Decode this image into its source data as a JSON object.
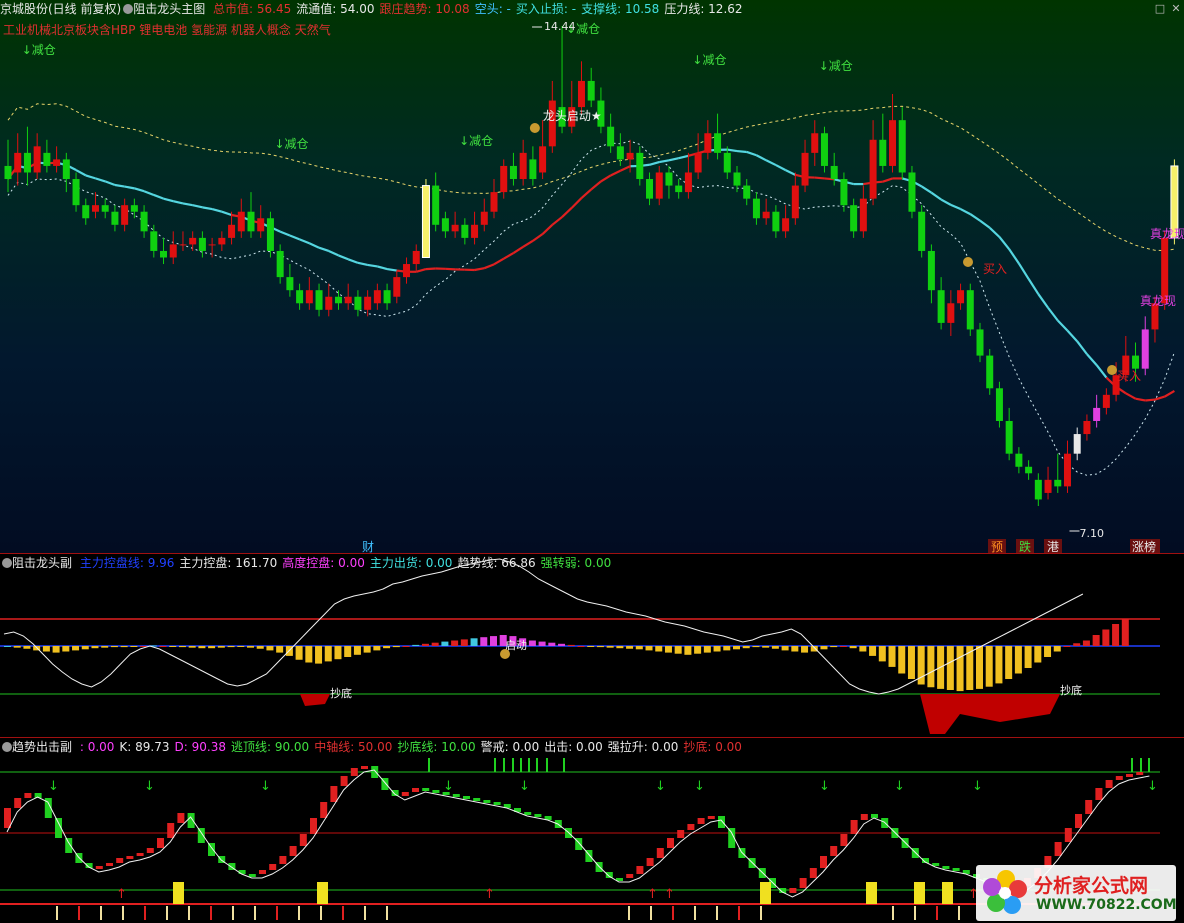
{
  "main": {
    "stock_name": "京城股份(日线 前复权)",
    "indicator": "阻击龙头主图",
    "fields": [
      {
        "label": "总市值:",
        "value": "56.45",
        "color": "#e03030"
      },
      {
        "label": "流通值:",
        "value": "54.00",
        "color": "#e8e8e8"
      },
      {
        "label": "跟庄趋势:",
        "value": "10.08",
        "color": "#e03030"
      },
      {
        "label": "空头:",
        "value": "-",
        "color": "#40c0ff"
      },
      {
        "label": "买入止损:",
        "value": "-",
        "color": "#40e0e0"
      },
      {
        "label": "支撑线:",
        "value": "10.58",
        "color": "#40e0e0"
      },
      {
        "label": "压力线:",
        "value": "12.62",
        "color": "#e8e8e8"
      }
    ],
    "concepts": "工业机械北京板块含HBP 锂电电池 氢能源 机器人概念 天然气",
    "high_label": "14.44",
    "low_label": "7.10",
    "labels": {
      "reduce": "减仓",
      "dragon_start": "龙头启动★",
      "true_dragon": "真龙现",
      "buy": "买入"
    },
    "bottom_tags": {
      "cai": "财",
      "yu": "预",
      "die": "跌",
      "gang": "港",
      "zhangbang": "涨榜"
    }
  },
  "sub": {
    "indicator": "阻击龙头副",
    "fields": [
      {
        "label": "主力控盘线:",
        "value": "9.96",
        "color": "#2040ff"
      },
      {
        "label": "主力控盘:",
        "value": "161.70",
        "color": "#e8e8e8"
      },
      {
        "label": "高度控盘:",
        "value": "0.00",
        "color": "#ff40ff"
      },
      {
        "label": "主力出货:",
        "value": "0.00",
        "color": "#40e0e0"
      },
      {
        "label": "趋势线:",
        "value": "66.86",
        "color": "#e8e8e8"
      },
      {
        "label": "强转弱:",
        "value": "0.00",
        "color": "#40e040"
      }
    ],
    "labels": {
      "bottom": "抄底",
      "start": "启动"
    }
  },
  "kdj": {
    "indicator": "趋势出击副",
    "fields": [
      {
        "label": ":",
        "value": "0.00",
        "color": "#ff40ff"
      },
      {
        "label": "K:",
        "value": "89.73",
        "color": "#e8e8e8"
      },
      {
        "label": "D:",
        "value": "90.38",
        "color": "#ff40ff"
      },
      {
        "label": "逃顶线:",
        "value": "90.00",
        "color": "#40e040"
      },
      {
        "label": "中轴线:",
        "value": "50.00",
        "color": "#e03030"
      },
      {
        "label": "抄底线:",
        "value": "10.00",
        "color": "#40e040"
      },
      {
        "label": "警戒:",
        "value": "0.00",
        "color": "#e8e8e8"
      },
      {
        "label": "出击:",
        "value": "0.00",
        "color": "#e8e8e8"
      },
      {
        "label": "强拉升:",
        "value": "0.00",
        "color": "#e8e8e8"
      },
      {
        "label": "抄底:",
        "value": "0.00",
        "color": "#e03030"
      }
    ]
  },
  "logo": {
    "name": "分析家公式网",
    "url": "WWW.70822.COM"
  },
  "chart_data": {
    "type": "candlestick",
    "y_range": [
      7.1,
      14.44
    ],
    "candles": [
      {
        "o": 12.3,
        "c": 12.1,
        "h": 12.7,
        "l": 11.9
      },
      {
        "o": 12.2,
        "c": 12.5,
        "h": 12.8,
        "l": 12.0
      },
      {
        "o": 12.5,
        "c": 12.2,
        "h": 12.9,
        "l": 12.0
      },
      {
        "o": 12.2,
        "c": 12.6,
        "h": 12.8,
        "l": 12.1
      },
      {
        "o": 12.5,
        "c": 12.3,
        "h": 12.7,
        "l": 12.2
      },
      {
        "o": 12.3,
        "c": 12.4,
        "h": 12.6,
        "l": 12.2
      },
      {
        "o": 12.4,
        "c": 12.1,
        "h": 12.5,
        "l": 11.9
      },
      {
        "o": 12.1,
        "c": 11.7,
        "h": 12.2,
        "l": 11.6
      },
      {
        "o": 11.7,
        "c": 11.5,
        "h": 11.8,
        "l": 11.4
      },
      {
        "o": 11.6,
        "c": 11.7,
        "h": 11.9,
        "l": 11.5
      },
      {
        "o": 11.7,
        "c": 11.6,
        "h": 11.8,
        "l": 11.5
      },
      {
        "o": 11.6,
        "c": 11.4,
        "h": 11.7,
        "l": 11.3
      },
      {
        "o": 11.4,
        "c": 11.7,
        "h": 11.8,
        "l": 11.3
      },
      {
        "o": 11.7,
        "c": 11.6,
        "h": 11.8,
        "l": 11.5
      },
      {
        "o": 11.6,
        "c": 11.3,
        "h": 11.7,
        "l": 11.2
      },
      {
        "o": 11.3,
        "c": 11.0,
        "h": 11.4,
        "l": 10.9
      },
      {
        "o": 11.0,
        "c": 10.9,
        "h": 11.2,
        "l": 10.8
      },
      {
        "o": 10.9,
        "c": 11.1,
        "h": 11.3,
        "l": 10.8
      },
      {
        "o": 11.1,
        "c": 11.1,
        "h": 11.3,
        "l": 11.0
      },
      {
        "o": 11.1,
        "c": 11.2,
        "h": 11.3,
        "l": 11.0
      },
      {
        "o": 11.2,
        "c": 11.0,
        "h": 11.3,
        "l": 10.9
      },
      {
        "o": 11.1,
        "c": 11.1,
        "h": 11.2,
        "l": 10.9
      },
      {
        "o": 11.1,
        "c": 11.2,
        "h": 11.3,
        "l": 11.0
      },
      {
        "o": 11.2,
        "c": 11.4,
        "h": 11.6,
        "l": 11.1
      },
      {
        "o": 11.3,
        "c": 11.6,
        "h": 11.8,
        "l": 11.2
      },
      {
        "o": 11.6,
        "c": 11.3,
        "h": 11.9,
        "l": 11.2
      },
      {
        "o": 11.3,
        "c": 11.5,
        "h": 11.7,
        "l": 11.2
      },
      {
        "o": 11.5,
        "c": 11.0,
        "h": 11.6,
        "l": 10.9
      },
      {
        "o": 11.0,
        "c": 10.6,
        "h": 11.1,
        "l": 10.5
      },
      {
        "o": 10.6,
        "c": 10.4,
        "h": 10.8,
        "l": 10.3
      },
      {
        "o": 10.4,
        "c": 10.2,
        "h": 10.5,
        "l": 10.1
      },
      {
        "o": 10.2,
        "c": 10.4,
        "h": 10.6,
        "l": 10.1
      },
      {
        "o": 10.4,
        "c": 10.1,
        "h": 10.5,
        "l": 10.0
      },
      {
        "o": 10.1,
        "c": 10.3,
        "h": 10.5,
        "l": 10.0
      },
      {
        "o": 10.3,
        "c": 10.2,
        "h": 10.4,
        "l": 10.1
      },
      {
        "o": 10.2,
        "c": 10.3,
        "h": 10.5,
        "l": 10.1
      },
      {
        "o": 10.3,
        "c": 10.1,
        "h": 10.4,
        "l": 10.0
      },
      {
        "o": 10.1,
        "c": 10.3,
        "h": 10.4,
        "l": 10.0
      },
      {
        "o": 10.2,
        "c": 10.4,
        "h": 10.5,
        "l": 10.1
      },
      {
        "o": 10.4,
        "c": 10.2,
        "h": 10.5,
        "l": 10.1
      },
      {
        "o": 10.3,
        "c": 10.6,
        "h": 10.7,
        "l": 10.2
      },
      {
        "o": 10.6,
        "c": 10.8,
        "h": 10.9,
        "l": 10.5
      },
      {
        "o": 10.8,
        "c": 11.0,
        "h": 11.1,
        "l": 10.7
      },
      {
        "o": 10.9,
        "c": 12.0,
        "h": 12.1,
        "l": 10.9
      },
      {
        "o": 12.0,
        "c": 11.4,
        "h": 12.2,
        "l": 11.3
      },
      {
        "o": 11.5,
        "c": 11.3,
        "h": 11.6,
        "l": 11.2
      },
      {
        "o": 11.3,
        "c": 11.4,
        "h": 11.6,
        "l": 11.2
      },
      {
        "o": 11.4,
        "c": 11.2,
        "h": 11.5,
        "l": 11.1
      },
      {
        "o": 11.2,
        "c": 11.4,
        "h": 11.6,
        "l": 11.1
      },
      {
        "o": 11.4,
        "c": 11.6,
        "h": 11.8,
        "l": 11.3
      },
      {
        "o": 11.6,
        "c": 11.9,
        "h": 12.1,
        "l": 11.5
      },
      {
        "o": 11.9,
        "c": 12.3,
        "h": 12.4,
        "l": 11.8
      },
      {
        "o": 12.3,
        "c": 12.1,
        "h": 12.5,
        "l": 12.0
      },
      {
        "o": 12.1,
        "c": 12.5,
        "h": 12.7,
        "l": 12.0
      },
      {
        "o": 12.4,
        "c": 12.1,
        "h": 12.6,
        "l": 12.0
      },
      {
        "o": 12.2,
        "c": 12.6,
        "h": 13.0,
        "l": 12.1
      },
      {
        "o": 12.6,
        "c": 13.3,
        "h": 13.6,
        "l": 12.5
      },
      {
        "o": 13.2,
        "c": 12.9,
        "h": 14.44,
        "l": 12.8
      },
      {
        "o": 12.9,
        "c": 13.2,
        "h": 13.6,
        "l": 12.8
      },
      {
        "o": 13.2,
        "c": 13.6,
        "h": 13.9,
        "l": 13.1
      },
      {
        "o": 13.6,
        "c": 13.3,
        "h": 13.8,
        "l": 13.2
      },
      {
        "o": 13.3,
        "c": 12.9,
        "h": 13.5,
        "l": 12.8
      },
      {
        "o": 12.9,
        "c": 12.6,
        "h": 13.1,
        "l": 12.5
      },
      {
        "o": 12.6,
        "c": 12.4,
        "h": 12.8,
        "l": 12.3
      },
      {
        "o": 12.4,
        "c": 12.5,
        "h": 12.7,
        "l": 12.2
      },
      {
        "o": 12.5,
        "c": 12.1,
        "h": 12.6,
        "l": 12.0
      },
      {
        "o": 12.1,
        "c": 11.8,
        "h": 12.2,
        "l": 11.7
      },
      {
        "o": 11.8,
        "c": 12.2,
        "h": 12.3,
        "l": 11.7
      },
      {
        "o": 12.2,
        "c": 12.0,
        "h": 12.3,
        "l": 11.8
      },
      {
        "o": 12.0,
        "c": 11.9,
        "h": 12.1,
        "l": 11.8
      },
      {
        "o": 11.9,
        "c": 12.2,
        "h": 12.5,
        "l": 11.8
      },
      {
        "o": 12.2,
        "c": 12.5,
        "h": 12.8,
        "l": 12.1
      },
      {
        "o": 12.5,
        "c": 12.8,
        "h": 13.0,
        "l": 12.4
      },
      {
        "o": 12.8,
        "c": 12.5,
        "h": 13.1,
        "l": 12.4
      },
      {
        "o": 12.5,
        "c": 12.2,
        "h": 12.6,
        "l": 12.1
      },
      {
        "o": 12.2,
        "c": 12.0,
        "h": 12.3,
        "l": 11.9
      },
      {
        "o": 12.0,
        "c": 11.8,
        "h": 12.1,
        "l": 11.7
      },
      {
        "o": 11.8,
        "c": 11.5,
        "h": 11.9,
        "l": 11.4
      },
      {
        "o": 11.5,
        "c": 11.6,
        "h": 11.8,
        "l": 11.4
      },
      {
        "o": 11.6,
        "c": 11.3,
        "h": 11.7,
        "l": 11.2
      },
      {
        "o": 11.3,
        "c": 11.5,
        "h": 11.7,
        "l": 11.2
      },
      {
        "o": 11.5,
        "c": 12.0,
        "h": 12.2,
        "l": 11.4
      },
      {
        "o": 12.0,
        "c": 12.5,
        "h": 12.7,
        "l": 11.9
      },
      {
        "o": 12.5,
        "c": 12.8,
        "h": 13.0,
        "l": 12.3
      },
      {
        "o": 12.8,
        "c": 12.3,
        "h": 12.9,
        "l": 12.2
      },
      {
        "o": 12.3,
        "c": 12.1,
        "h": 12.5,
        "l": 12.0
      },
      {
        "o": 12.1,
        "c": 11.7,
        "h": 12.2,
        "l": 11.6
      },
      {
        "o": 11.7,
        "c": 11.3,
        "h": 11.8,
        "l": 11.2
      },
      {
        "o": 11.3,
        "c": 11.8,
        "h": 12.0,
        "l": 11.2
      },
      {
        "o": 11.8,
        "c": 12.7,
        "h": 13.0,
        "l": 11.7
      },
      {
        "o": 12.7,
        "c": 12.3,
        "h": 13.1,
        "l": 12.2
      },
      {
        "o": 12.3,
        "c": 13.0,
        "h": 13.4,
        "l": 12.2
      },
      {
        "o": 13.0,
        "c": 12.2,
        "h": 13.2,
        "l": 12.1
      },
      {
        "o": 12.2,
        "c": 11.6,
        "h": 12.3,
        "l": 11.5
      },
      {
        "o": 11.6,
        "c": 11.0,
        "h": 11.7,
        "l": 10.9
      },
      {
        "o": 11.0,
        "c": 10.4,
        "h": 11.1,
        "l": 10.2
      },
      {
        "o": 10.4,
        "c": 9.9,
        "h": 10.6,
        "l": 9.8
      },
      {
        "o": 9.9,
        "c": 10.2,
        "h": 10.4,
        "l": 9.7
      },
      {
        "o": 10.2,
        "c": 10.4,
        "h": 10.5,
        "l": 10.1
      },
      {
        "o": 10.4,
        "c": 9.8,
        "h": 10.5,
        "l": 9.7
      },
      {
        "o": 9.8,
        "c": 9.4,
        "h": 9.9,
        "l": 9.3
      },
      {
        "o": 9.4,
        "c": 8.9,
        "h": 9.5,
        "l": 8.8
      },
      {
        "o": 8.9,
        "c": 8.4,
        "h": 9.0,
        "l": 8.3
      },
      {
        "o": 8.4,
        "c": 7.9,
        "h": 8.6,
        "l": 7.8
      },
      {
        "o": 7.9,
        "c": 7.7,
        "h": 8.0,
        "l": 7.6
      },
      {
        "o": 7.7,
        "c": 7.6,
        "h": 7.8,
        "l": 7.5
      },
      {
        "o": 7.5,
        "c": 7.2,
        "h": 7.6,
        "l": 7.1
      },
      {
        "o": 7.3,
        "c": 7.5,
        "h": 7.7,
        "l": 7.2
      },
      {
        "o": 7.5,
        "c": 7.4,
        "h": 7.9,
        "l": 7.3
      },
      {
        "o": 7.4,
        "c": 7.9,
        "h": 8.1,
        "l": 7.3
      },
      {
        "o": 7.9,
        "c": 8.2,
        "h": 8.3,
        "l": 7.8
      },
      {
        "o": 8.2,
        "c": 8.4,
        "h": 8.5,
        "l": 8.1
      },
      {
        "o": 8.4,
        "c": 8.6,
        "h": 8.8,
        "l": 8.3
      },
      {
        "o": 8.6,
        "c": 8.8,
        "h": 8.9,
        "l": 8.5
      },
      {
        "o": 8.8,
        "c": 9.1,
        "h": 9.3,
        "l": 8.7
      },
      {
        "o": 9.1,
        "c": 9.4,
        "h": 9.7,
        "l": 9.0
      },
      {
        "o": 9.4,
        "c": 9.2,
        "h": 9.6,
        "l": 9.0
      },
      {
        "o": 9.2,
        "c": 9.8,
        "h": 10.0,
        "l": 9.1
      },
      {
        "o": 9.8,
        "c": 10.2,
        "h": 10.3,
        "l": 9.6
      },
      {
        "o": 10.2,
        "c": 11.2,
        "h": 11.3,
        "l": 10.1
      },
      {
        "o": 11.2,
        "c": 12.3,
        "h": 12.4,
        "l": 11.1
      }
    ]
  }
}
